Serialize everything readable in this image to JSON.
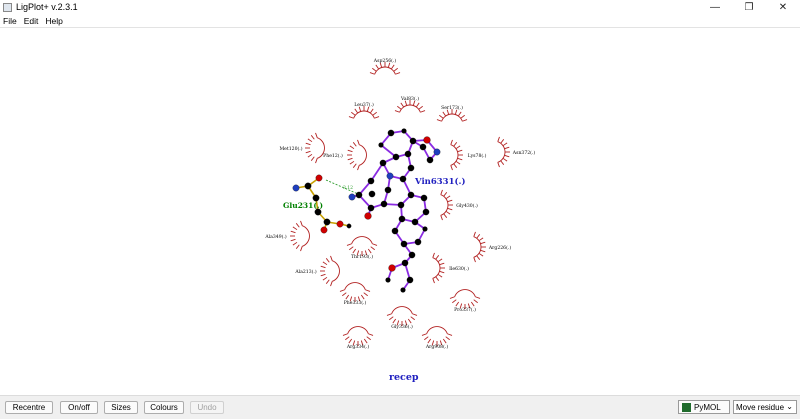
{
  "window": {
    "title": "LigPlot+ v.2.3.1",
    "controls": [
      "—",
      "❐",
      "✕"
    ]
  },
  "menu": [
    "File",
    "Edit",
    "Help"
  ],
  "plot": {
    "ligand_label": "Vin6331(.)",
    "hbond_residue_label": "Glu231(.)",
    "hbond_distance": "3.12",
    "receptor_label": "recep",
    "residues": [
      "Asp256(.)",
      "Leu37(.)",
      "Val83(.)",
      "Ser173(.)",
      "Met120(.)",
      "Phe12(.)",
      "Lys78(.)",
      "Asn372(.)",
      "Gly430(.)",
      "Ala349(.)",
      "Thr193(.)",
      "Arg226(.)",
      "Ala213(.)",
      "Ile630(.)",
      "Phe333(.)",
      "Pro337(.)",
      "Gly336(.)",
      "Arg334(.)",
      "Arg908(.)"
    ],
    "colors": {
      "ligand_bond": "#8a2be2",
      "carbon": "#000000",
      "oxygen": "#d00000",
      "nitrogen": "#1f3fbf",
      "hbond_residue_bond": "#c8a000",
      "hbond_line": "#2a9a2a",
      "hydrophobic_arc": "#b22222",
      "ligand_label": "#2020c0",
      "hbond_label": "#008000",
      "receptor_label": "#2020c0"
    }
  },
  "toolbar": {
    "recentre": "Recentre",
    "onoff": "On/off",
    "sizes": "Sizes",
    "colours": "Colours",
    "undo": "Undo",
    "pymol": "PyMOL",
    "mode": "Move residue"
  }
}
